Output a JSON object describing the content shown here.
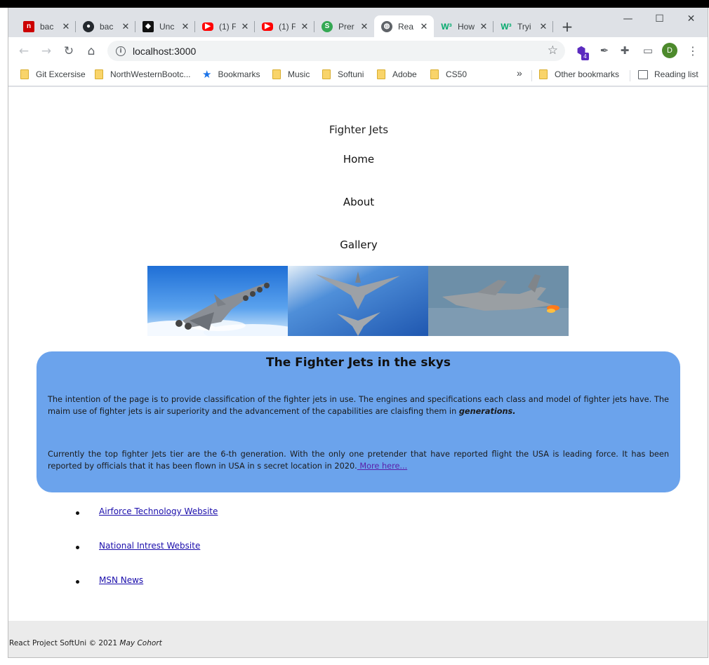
{
  "browser": {
    "tabs": [
      {
        "title": "bac",
        "icon": "n-square-icon",
        "color": "#cc0000"
      },
      {
        "title": "bac",
        "icon": "github-icon",
        "color": "#24292e"
      },
      {
        "title": "Unc",
        "icon": "codepen-icon",
        "color": "#111111"
      },
      {
        "title": "(1) F",
        "icon": "youtube-icon",
        "color": "#ff0000"
      },
      {
        "title": "(1) F",
        "icon": "youtube-icon",
        "color": "#ff0000"
      },
      {
        "title": "Prer",
        "icon": "s-circle-icon",
        "color": "#34a853"
      },
      {
        "title": "Rea",
        "icon": "globe-icon",
        "color": "#5f6368",
        "active": true
      },
      {
        "title": "How",
        "icon": "w3-icon",
        "color": "#04aa6d"
      },
      {
        "title": "Tryi",
        "icon": "w3-icon",
        "color": "#04aa6d"
      }
    ],
    "url": "localhost:3000",
    "extensions_badge": "4",
    "profile_initial": "D",
    "bookmarks": [
      {
        "label": "Git Excersise",
        "type": "folder"
      },
      {
        "label": "NorthWesternBootc...",
        "type": "folder"
      },
      {
        "label": "Bookmarks",
        "type": "star"
      },
      {
        "label": "Music",
        "type": "folder"
      },
      {
        "label": "Softuni",
        "type": "folder"
      },
      {
        "label": "Adobe",
        "type": "folder"
      },
      {
        "label": "CS50",
        "type": "folder"
      }
    ],
    "overflow": "»",
    "other_bookmarks": "Other bookmarks",
    "reading_list": "Reading list"
  },
  "site": {
    "title": "Fighter Jets",
    "nav": [
      "Home",
      "About",
      "Gallery"
    ],
    "gallery": [
      {
        "name": "jet-image-1"
      },
      {
        "name": "jet-image-2"
      },
      {
        "name": "jet-image-3"
      }
    ],
    "panel": {
      "heading": "The Fighter Jets in the skys",
      "p1_text": "The intention of the page is to provide classification of the fighter jets in use. The engines and specifications each class and model of fighter jets have. The maim use of fighter jets is air superiority and the advancement of the capabilities are claisfing them in ",
      "p1_emph": "generations.",
      "p2_text": "Currently the top fighter Jets tier are the 6-th generation. With the only one pretender that have reported flight the USA is leading force. It has been reported by officials that it has been flown in USA in s secret location in 2020.",
      "p2_link": " More here..."
    },
    "links": [
      "Airforce Technology Website",
      "National Intrest Website",
      "MSN News"
    ],
    "footer": {
      "text": "React Project SoftUni © 2021 ",
      "emph": "May Cohort"
    }
  },
  "colors": {
    "panel": "#6ba3ec",
    "footer": "#ebebeb",
    "link": "#1a0dab",
    "visited": "#5a1fa8"
  }
}
